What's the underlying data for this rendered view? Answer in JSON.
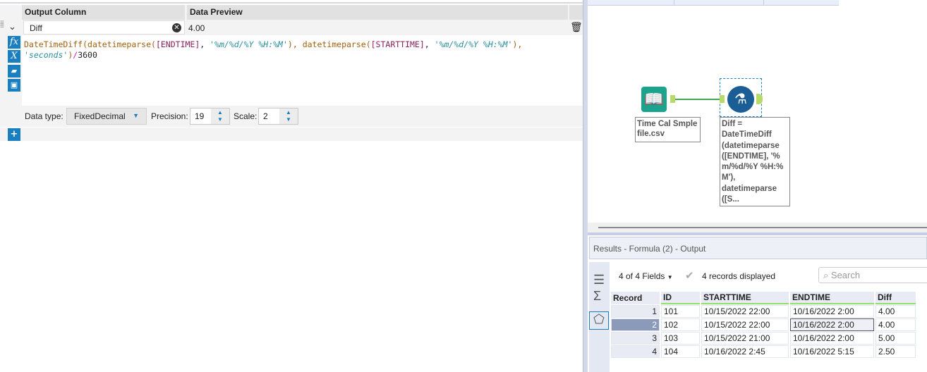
{
  "formula_panel": {
    "headers": {
      "output_column": "Output Column",
      "data_preview": "Data Preview"
    },
    "row": {
      "column_name": "Diff",
      "preview": "4.00"
    },
    "expression": {
      "line1_parts": [
        "DateTimeDiff(",
        "datetimeparse(",
        "[ENDTIME]",
        ", ",
        "'%m/%d/%Y %H:%M'",
        "), ",
        "datetimeparse(",
        "[STARTTIME]",
        ", ",
        "'%m/%d/%Y %H:%M'",
        "),"
      ],
      "line2_parts": [
        "'seconds'",
        ")",
        "/",
        "3600"
      ]
    },
    "data_type_label": "Data type:",
    "data_type": "FixedDecimal",
    "precision_label": "Precision:",
    "precision": "19",
    "scale_label": "Scale:",
    "scale": "2",
    "icons": {
      "fx": "fx",
      "x": "X"
    }
  },
  "canvas": {
    "input_tool_label": "Time Cal Smple file.csv",
    "formula_tool_label": "Diff = DateTimeDiff (datetimeparse ([ENDTIME], '% m/%d/%Y %H:% M'), datetimeparse ([S..."
  },
  "results": {
    "title": "Results - Formula (2) - Output",
    "fields": "4 of 4 Fields",
    "records_text": "4 records displayed",
    "search_placeholder": "Search",
    "columns": [
      "Record",
      "ID",
      "STARTTIME",
      "ENDTIME",
      "Diff"
    ],
    "rows": [
      [
        "1",
        "101",
        "10/15/2022 22:00",
        "10/16/2022 2:00",
        "4.00"
      ],
      [
        "2",
        "102",
        "10/15/2022 22:00",
        "10/16/2022 2:00",
        "4.00"
      ],
      [
        "3",
        "103",
        "10/15/2022 21:00",
        "10/16/2022 2:00",
        "5.00"
      ],
      [
        "4",
        "104",
        "10/16/2022 2:45",
        "10/16/2022 5:15",
        "2.50"
      ]
    ]
  }
}
